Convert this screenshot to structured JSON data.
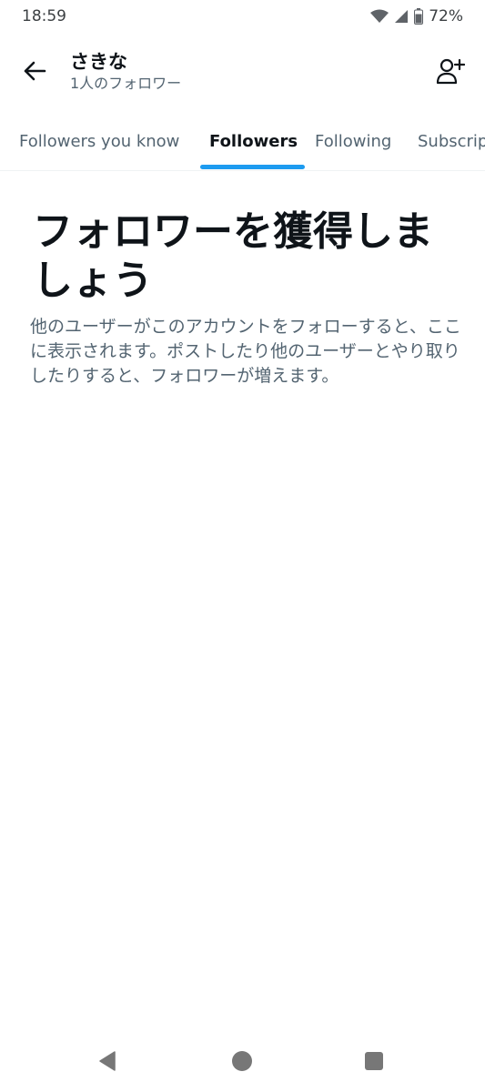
{
  "status_bar": {
    "time": "18:59",
    "battery": "72%",
    "icons": [
      "wifi-icon",
      "cell-signal-icon",
      "battery-icon"
    ]
  },
  "header": {
    "title": "さきな",
    "subtitle": "1人のフォロワー",
    "back_icon": "arrow-left-icon",
    "add_user_icon": "person-add-icon"
  },
  "tabs": [
    {
      "label": "Followers you know",
      "active": false
    },
    {
      "label": "Followers",
      "active": true
    },
    {
      "label": "Following",
      "active": false
    },
    {
      "label": "Subscriptions",
      "active": false
    }
  ],
  "empty_state": {
    "title": "フォロワーを獲得しましょう",
    "description": "他のユーザーがこのアカウントをフォローすると、ここに表示されます。ポストしたり他のユーザーとやり取りしたりすると、フォロワーが増えます。"
  },
  "nav_bar": {
    "icons": [
      "back-triangle-icon",
      "home-circle-icon",
      "recents-square-icon"
    ]
  },
  "colors": {
    "accent": "#1d9bf0",
    "text_primary": "#0f1419",
    "text_secondary": "#536471"
  }
}
